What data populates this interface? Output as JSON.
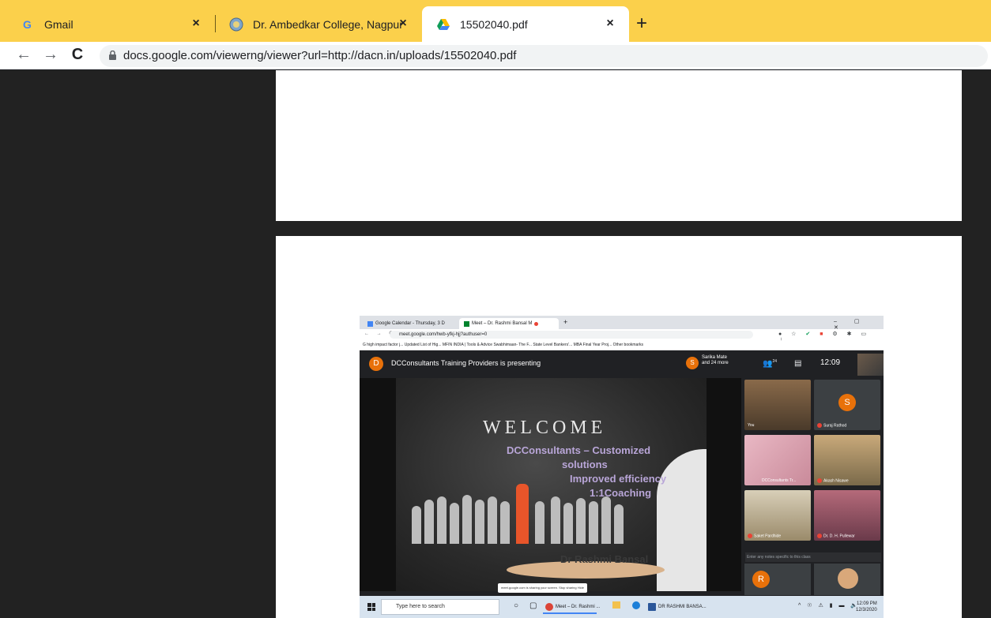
{
  "browser": {
    "tabs": [
      {
        "title": "Gmail",
        "icon": "gmail-icon"
      },
      {
        "title": "Dr. Ambedkar College, Nagpur",
        "icon": "college-logo-icon"
      },
      {
        "title": "15502040.pdf",
        "icon": "google-drive-icon",
        "active": true
      }
    ],
    "new_tab": "+",
    "close_glyph": "×",
    "url": "docs.google.com/viewerng/viewer?url=http://dacn.in/uploads/15502040.pdf",
    "back": "←",
    "forward": "→",
    "reload": "C"
  },
  "screenshot": {
    "tabs": [
      "Google Calendar - Thursday, 3 D",
      "Meet – Dr. Rashmi Bansal M"
    ],
    "url": "meet.google.com/hwb-yfkj-hjj?authuser=0",
    "bookmarks": "G  high impact factor j...   Updated List of Hig...   MFIN INDIA |   Tools & Advice   Swabhimaan- The F...   State Level Bankers'...   MBA Final Year Proj...        Other bookmarks",
    "presenter_initial": "D",
    "presenting": "DCConsultants Training Providers is presenting",
    "sarika_initial": "S",
    "sarika_line1": "Sarika Mate",
    "sarika_line2": "and 24 more",
    "people_count": "24",
    "time": "12:09",
    "slide": {
      "welcome": "WELCOME",
      "line1": "DCConsultants – Customized",
      "line2": "solutions",
      "line3": "Improved efficiency",
      "line4": "1:1Coaching",
      "presenter": "Dr Rashmi Bansal"
    },
    "participants": [
      {
        "name": "You"
      },
      {
        "name": "Suraj Rathod",
        "initial": "S"
      },
      {
        "name": "DCConsultants Tr..."
      },
      {
        "name": "Akash Nisawe"
      },
      {
        "name": "Saket Pardhide"
      },
      {
        "name": "Dr. D. H. Pullewar"
      },
      {
        "name": "",
        "initial": "R"
      }
    ],
    "chat_placeholder": "Enter any notes specific to this class",
    "notice": "meet.google.com is sharing your screen.   Stop sharing    Hide",
    "taskbar": {
      "search": "Type here to search",
      "app1": "Meet – Dr. Rashmi ...",
      "app2": "DR RASHMI BANSA...",
      "time": "12:09 PM",
      "date": "12/3/2020"
    }
  }
}
